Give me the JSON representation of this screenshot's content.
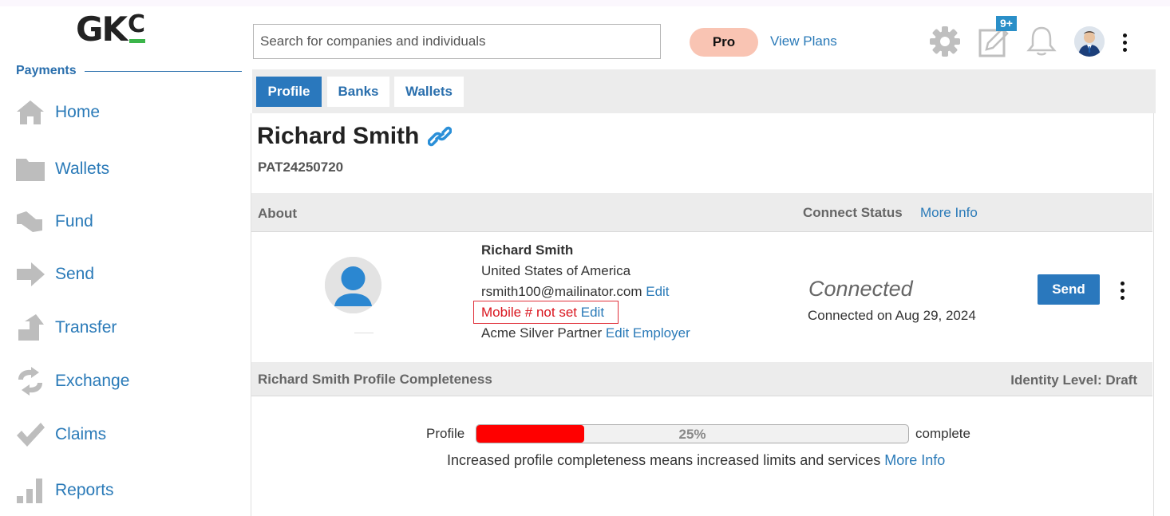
{
  "app": {
    "logo_text": "GK",
    "logo_superscript": "C"
  },
  "sidebar": {
    "section_title": "Payments",
    "items": [
      {
        "label": "Home",
        "icon": "home-icon"
      },
      {
        "label": "Wallets",
        "icon": "folder-icon"
      },
      {
        "label": "Fund",
        "icon": "fund-icon"
      },
      {
        "label": "Send",
        "icon": "send-arrow-icon"
      },
      {
        "label": "Transfer",
        "icon": "transfer-arrow-icon"
      },
      {
        "label": "Exchange",
        "icon": "exchange-icon"
      },
      {
        "label": "Claims",
        "icon": "checkmark-icon"
      },
      {
        "label": "Reports",
        "icon": "bar-chart-icon"
      }
    ]
  },
  "header": {
    "search_placeholder": "Search for companies and individuals",
    "pro_label": "Pro",
    "view_plans_label": "View Plans",
    "notes_badge": "9+",
    "icons": [
      "gear-icon",
      "notes-edit-icon",
      "bell-icon",
      "user-avatar",
      "more-vertical-icon"
    ]
  },
  "tabs": [
    {
      "label": "Profile",
      "active": true
    },
    {
      "label": "Banks",
      "active": false
    },
    {
      "label": "Wallets",
      "active": false
    }
  ],
  "profile": {
    "name": "Richard Smith",
    "id": "PAT24250720",
    "about_label": "About",
    "connect_status_label": "Connect Status",
    "more_info_label": "More Info",
    "details": {
      "name": "Richard Smith",
      "country": "United States of America",
      "email": "rsmith100@mailinator.com",
      "email_edit": "Edit",
      "mobile": "Mobile # not set",
      "mobile_edit": "Edit",
      "employer": "Acme Silver Partner",
      "employer_edit": "Edit Employer"
    },
    "status": "Connected",
    "connected_on": "Connected on Aug 29, 2024",
    "send_label": "Send"
  },
  "completeness": {
    "title": "Richard Smith Profile Completeness",
    "identity_level": "Identity Level: Draft",
    "profile_label": "Profile",
    "percent": 25,
    "percent_text": "25%",
    "complete_label": "complete",
    "note": "Increased profile completeness means increased limits and services",
    "more_info_label": "More Info"
  },
  "colors": {
    "accent": "#2a78bd",
    "link": "#2a7ab8",
    "progress": "#ff0000",
    "pro_badge": "#f9c4b3",
    "logo_green": "#3bb54a",
    "warning": "#d9141d"
  }
}
